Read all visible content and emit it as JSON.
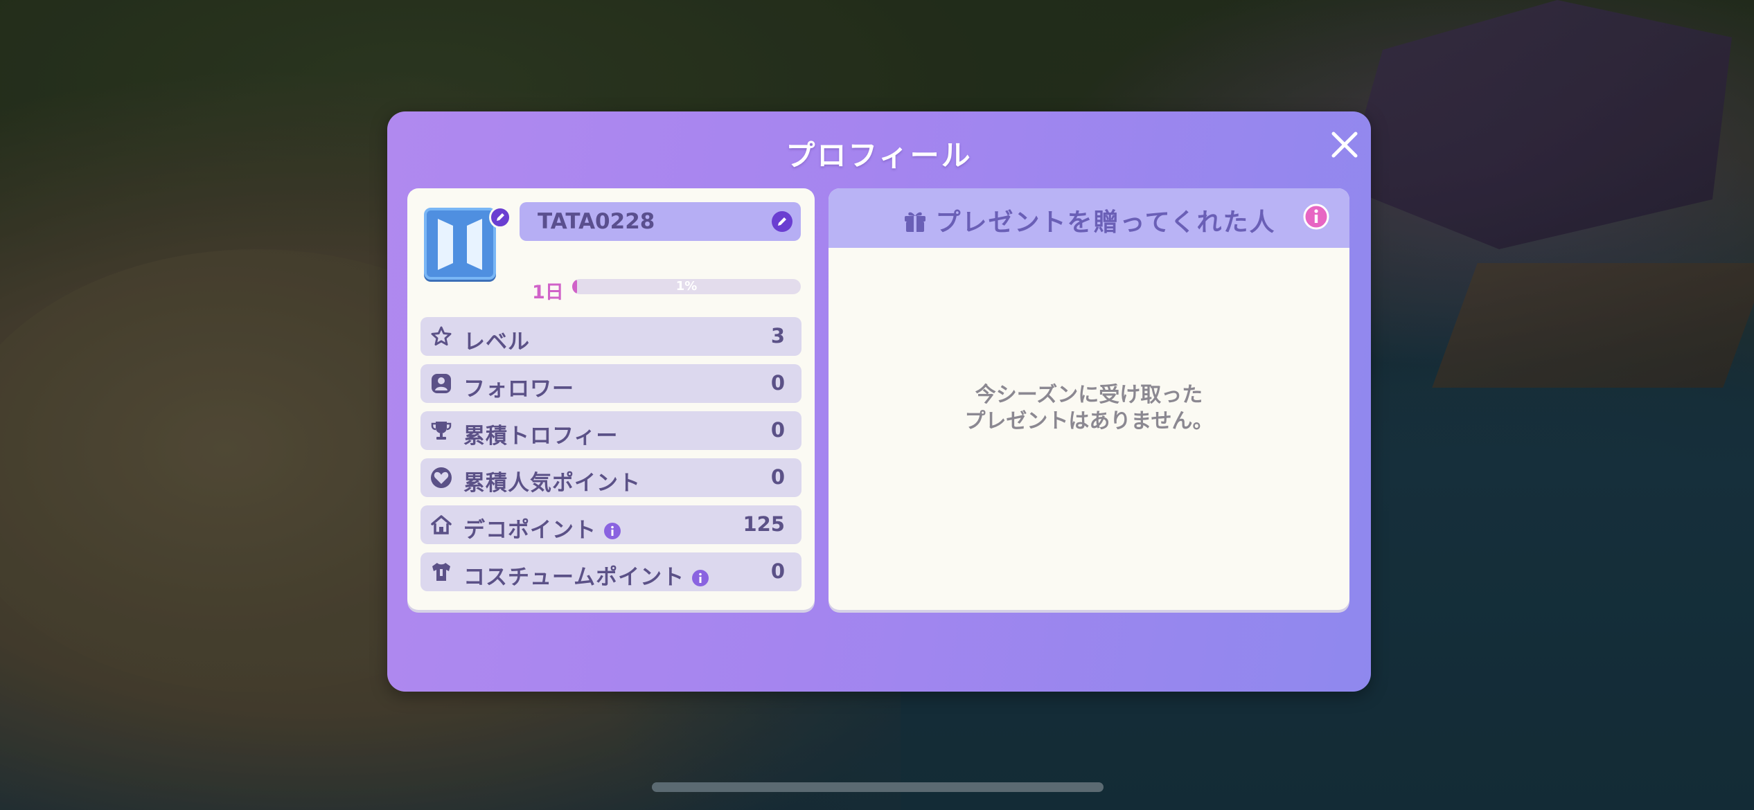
{
  "dialog": {
    "title": "プロフィール",
    "close_icon": "close-icon"
  },
  "profile": {
    "avatar_icon": "bts-logo",
    "username": "TATA0228",
    "day_label": "1日",
    "progress_text": "1%",
    "progress_fraction": 0.01
  },
  "stats": [
    {
      "icon": "star-icon",
      "label": "レベル",
      "value": "3",
      "info": false
    },
    {
      "icon": "follower-icon",
      "label": "フォロワー",
      "value": "0",
      "info": false
    },
    {
      "icon": "trophy-icon",
      "label": "累積トロフィー",
      "value": "0",
      "info": false
    },
    {
      "icon": "heart-icon",
      "label": "累積人気ポイント",
      "value": "0",
      "info": false
    },
    {
      "icon": "house-icon",
      "label": "デコポイント",
      "value": "125",
      "info": true
    },
    {
      "icon": "shirt-icon",
      "label": "コスチュームポイント",
      "value": "0",
      "info": true
    }
  ],
  "gifts": {
    "title": "プレゼントを贈ってくれた人",
    "empty_line1": "今シーズンに受け取った",
    "empty_line2": "プレゼントはありません。"
  },
  "colors": {
    "accent_purple": "#6a3ed1",
    "pink": "#d062c8",
    "dialog_gradient_start": "#b089ef",
    "dialog_gradient_end": "#8f88ee"
  }
}
